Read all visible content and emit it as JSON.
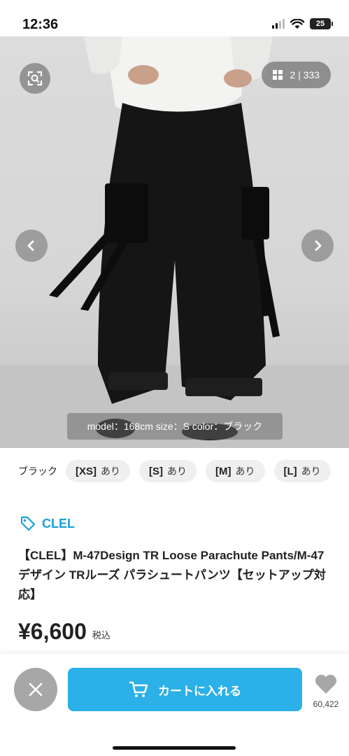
{
  "status_bar": {
    "time": "12:36",
    "battery": "25"
  },
  "photo": {
    "counter": "2 | 333",
    "caption": "model：168cm size：S color：ブラック"
  },
  "variants": {
    "color_label": "ブラック",
    "options": [
      {
        "size": "[XS]",
        "stock": "あり"
      },
      {
        "size": "[S]",
        "stock": "あり"
      },
      {
        "size": "[M]",
        "stock": "あり"
      },
      {
        "size": "[L]",
        "stock": "あり"
      }
    ]
  },
  "brand": {
    "name": "CLEL",
    "color": "#1aa0d8"
  },
  "product": {
    "title": "【CLEL】M-47Design TR Loose Parachute Pants/M-47デザイン TRルーズ パラシュートパンツ【セットアップ対応】",
    "price": "¥6,600",
    "tax_label": "税込"
  },
  "actions": {
    "cart_label": "カートに入れる",
    "cart_color": "#2bb0e8",
    "favorite_count": "60,422"
  }
}
